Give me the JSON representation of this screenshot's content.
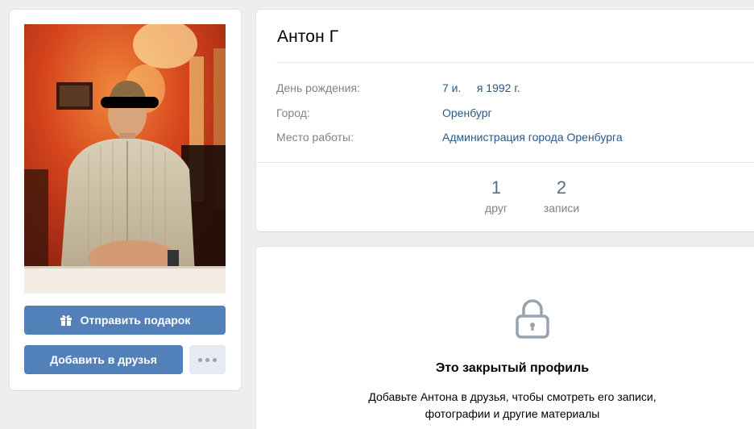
{
  "profile": {
    "name": "Антон Г",
    "photo_alt": "фото профиля"
  },
  "actions": {
    "gift_label": "Отправить подарок",
    "add_friend_label": "Добавить в друзья",
    "more_icon": "more-dots-icon"
  },
  "info": {
    "rows": [
      {
        "label": "День рождения:",
        "value": "7 и.     я 1992 г."
      },
      {
        "label": "Город:",
        "value": "Оренбург"
      },
      {
        "label": "Место работы:",
        "value": "Администрация города Оренбурга"
      }
    ]
  },
  "counters": [
    {
      "count": "1",
      "label": "друг"
    },
    {
      "count": "2",
      "label": "записи"
    }
  ],
  "private": {
    "icon": "lock-icon",
    "title": "Это закрытый профиль",
    "line1": "Добавьте Антона в друзья, чтобы смотреть его записи,",
    "line2": "фотографии и другие материалы"
  },
  "colors": {
    "background": "#edeef0",
    "button_primary": "#5181b8",
    "button_secondary": "#e5ebf1",
    "link": "#2a5885",
    "label": "#828282"
  }
}
